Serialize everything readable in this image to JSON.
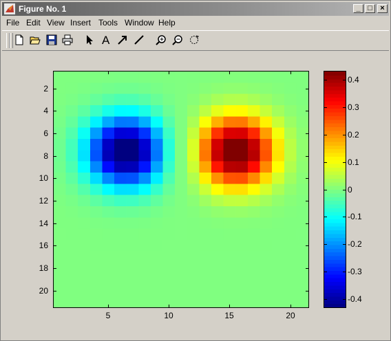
{
  "window": {
    "title": "Figure No. 1",
    "minimize_glyph": "_",
    "maximize_glyph": "□",
    "close_glyph": "×"
  },
  "menu": {
    "items": [
      {
        "label": "File"
      },
      {
        "label": "Edit"
      },
      {
        "label": "View"
      },
      {
        "label": "Insert"
      },
      {
        "label": "Tools"
      },
      {
        "label": "Window"
      },
      {
        "label": "Help"
      }
    ]
  },
  "toolbar": {
    "text_tool_label": "A",
    "tools": [
      "new-figure-icon",
      "open-file-icon",
      "save-icon",
      "print-icon",
      "select-arrow-icon",
      "text-icon",
      "arrow-icon",
      "line-icon",
      "zoom-in-icon",
      "zoom-out-icon",
      "rotate-3d-icon"
    ]
  },
  "chart_data": {
    "type": "heatmap",
    "title": "",
    "xlabel": "",
    "ylabel": "",
    "x_range": [
      0.5,
      21.5
    ],
    "y_range": [
      0.5,
      21.5
    ],
    "y_reversed": true,
    "x_ticks": [
      5,
      10,
      15,
      20
    ],
    "x_tick_labels": [
      "5",
      "10",
      "15",
      "20"
    ],
    "y_ticks": [
      2,
      4,
      6,
      8,
      10,
      12,
      14,
      16,
      18,
      20
    ],
    "y_tick_labels": [
      "2",
      "4",
      "6",
      "8",
      "10",
      "12",
      "14",
      "16",
      "18",
      "20"
    ],
    "grid_size": [
      21,
      21
    ],
    "values": [
      [
        -0.0001,
        -0.0003,
        -0.0008,
        -0.0016,
        -0.0025,
        -0.0031,
        -0.0031,
        -0.0025,
        -0.0014,
        -0.0005,
        0.0,
        0.0005,
        0.0014,
        0.0025,
        0.0031,
        0.0031,
        0.0025,
        0.0016,
        0.0008,
        0.0003,
        0.0001
      ],
      [
        -0.0004,
        -0.0014,
        -0.0036,
        -0.0069,
        -0.0105,
        -0.0129,
        -0.0128,
        -0.0102,
        -0.0061,
        -0.0021,
        0.0,
        0.0021,
        0.0061,
        0.0102,
        0.0128,
        0.0129,
        0.0105,
        0.0069,
        0.0036,
        0.0014,
        0.0004
      ],
      [
        -0.0014,
        -0.0047,
        -0.0118,
        -0.0227,
        -0.0345,
        -0.0424,
        -0.042,
        -0.0334,
        -0.0201,
        -0.007,
        0.0,
        0.007,
        0.0201,
        0.0334,
        0.042,
        0.0424,
        0.0345,
        0.0227,
        0.0118,
        0.0047,
        0.0014
      ],
      [
        -0.0035,
        -0.012,
        -0.0303,
        -0.0583,
        -0.0887,
        -0.1089,
        -0.108,
        -0.0859,
        -0.0515,
        -0.0179,
        0.0,
        0.0179,
        0.0515,
        0.0859,
        0.108,
        0.1089,
        0.0887,
        0.0583,
        0.0303,
        0.012,
        0.0035
      ],
      [
        -0.0071,
        -0.0243,
        -0.0614,
        -0.118,
        -0.1794,
        -0.2203,
        -0.2184,
        -0.1738,
        -0.1042,
        -0.0363,
        0.0,
        0.0363,
        0.1042,
        0.1738,
        0.2184,
        0.2203,
        0.1794,
        0.118,
        0.0614,
        0.0243,
        0.0071
      ],
      [
        -0.0114,
        -0.0391,
        -0.0989,
        -0.1902,
        -0.289,
        -0.3548,
        -0.3518,
        -0.2799,
        -0.1678,
        -0.0585,
        0.0,
        0.0585,
        0.1678,
        0.2799,
        0.3518,
        0.3548,
        0.289,
        0.1902,
        0.0989,
        0.0391,
        0.0114
      ],
      [
        -0.0146,
        -0.0502,
        -0.1271,
        -0.2444,
        -0.3714,
        -0.456,
        -0.452,
        -0.3597,
        -0.2157,
        -0.0751,
        0.0,
        0.0751,
        0.2157,
        0.3597,
        0.452,
        0.456,
        0.3714,
        0.2444,
        0.1271,
        0.0502,
        0.0146
      ],
      [
        -0.015,
        -0.0517,
        -0.1308,
        -0.2514,
        -0.3821,
        -0.4691,
        -0.465,
        -0.37,
        -0.2219,
        -0.0773,
        0.0,
        0.0773,
        0.2219,
        0.37,
        0.465,
        0.4691,
        0.3821,
        0.2514,
        0.1308,
        0.0517,
        0.015
      ],
      [
        -0.0123,
        -0.0425,
        -0.1076,
        -0.2068,
        -0.3143,
        -0.3859,
        -0.3825,
        -0.3044,
        -0.1825,
        -0.0636,
        0.0,
        0.0636,
        0.1825,
        0.3044,
        0.3825,
        0.3859,
        0.3143,
        0.2068,
        0.1076,
        0.0425,
        0.0123
      ],
      [
        -0.0081,
        -0.028,
        -0.0708,
        -0.136,
        -0.2067,
        -0.2538,
        -0.2516,
        -0.2002,
        -0.12,
        -0.0418,
        0.0,
        0.0418,
        0.12,
        0.2002,
        0.2516,
        0.2538,
        0.2067,
        0.136,
        0.0708,
        0.028,
        0.0081
      ],
      [
        -0.0043,
        -0.0147,
        -0.0372,
        -0.0716,
        -0.1088,
        -0.1336,
        -0.1324,
        -0.1054,
        -0.0632,
        -0.022,
        0.0,
        0.022,
        0.0632,
        0.1054,
        0.1324,
        0.1336,
        0.1088,
        0.0716,
        0.0372,
        0.0147,
        0.0043
      ],
      [
        -0.0018,
        -0.0062,
        -0.0156,
        -0.03,
        -0.0456,
        -0.056,
        -0.0555,
        -0.0442,
        -0.0265,
        -0.0092,
        0.0,
        0.0092,
        0.0265,
        0.0442,
        0.0555,
        0.056,
        0.0456,
        0.03,
        0.0156,
        0.0062,
        0.0018
      ],
      [
        -0.0006,
        -0.0021,
        -0.0052,
        -0.01,
        -0.0152,
        -0.0187,
        -0.0185,
        -0.0147,
        -0.0088,
        -0.0031,
        0.0,
        0.0031,
        0.0088,
        0.0147,
        0.0185,
        0.0187,
        0.0152,
        0.01,
        0.0052,
        0.0021,
        0.0006
      ],
      [
        -0.0002,
        -0.0006,
        -0.0014,
        -0.0027,
        -0.004,
        -0.005,
        -0.0049,
        -0.0039,
        -0.0024,
        -0.0008,
        0.0,
        0.0008,
        0.0024,
        0.0039,
        0.0049,
        0.005,
        0.004,
        0.0027,
        0.0014,
        0.0006,
        0.0002
      ],
      [
        0.0,
        -0.0001,
        -0.0003,
        -0.0006,
        -0.0009,
        -0.0011,
        -0.0011,
        -0.0008,
        -0.0005,
        -0.0002,
        0.0,
        0.0002,
        0.0005,
        0.0008,
        0.0011,
        0.0011,
        0.0009,
        0.0006,
        0.0003,
        0.0001,
        0.0
      ],
      [
        0.0,
        0.0,
        0.0,
        -0.0001,
        -0.0002,
        -0.0002,
        -0.0002,
        -0.0001,
        -0.0001,
        0.0,
        0.0,
        0.0,
        0.0001,
        0.0001,
        0.0002,
        0.0002,
        0.0002,
        0.0001,
        0.0,
        0.0,
        0.0
      ],
      [
        0.0,
        0.0,
        0.0,
        0.0,
        0.0,
        0.0,
        0.0,
        0.0,
        0.0,
        0.0,
        0.0,
        0.0,
        0.0,
        0.0,
        0.0,
        0.0,
        0.0,
        0.0,
        0.0,
        0.0,
        0.0
      ],
      [
        0.0,
        0.0,
        0.0,
        0.0,
        0.0,
        0.0,
        0.0,
        0.0,
        0.0,
        0.0,
        0.0,
        0.0,
        0.0,
        0.0,
        0.0,
        0.0,
        0.0,
        0.0,
        0.0,
        0.0,
        0.0
      ],
      [
        0.0,
        0.0,
        0.0,
        0.0,
        0.0,
        0.0,
        0.0,
        0.0,
        0.0,
        0.0,
        0.0,
        0.0,
        0.0,
        0.0,
        0.0,
        0.0,
        0.0,
        0.0,
        0.0,
        0.0,
        0.0
      ],
      [
        0.0,
        0.0,
        0.0,
        0.0,
        0.0,
        0.0,
        0.0,
        0.0,
        0.0,
        0.0,
        0.0,
        0.0,
        0.0,
        0.0,
        0.0,
        0.0,
        0.0,
        0.0,
        0.0,
        0.0,
        0.0
      ],
      [
        0.0,
        0.0,
        0.0,
        0.0,
        0.0,
        0.0,
        0.0,
        0.0,
        0.0,
        0.0,
        0.0,
        0.0,
        0.0,
        0.0,
        0.0,
        0.0,
        0.0,
        0.0,
        0.0,
        0.0,
        0.0
      ]
    ],
    "colormap": "jet",
    "clim": [
      -0.43,
      0.43
    ],
    "colorbar": {
      "placement": "right",
      "ticks": [
        0.4,
        0.3,
        0.2,
        0.1,
        0,
        -0.1,
        -0.2,
        -0.3,
        -0.4
      ],
      "tick_labels": [
        "0.4",
        "0.3",
        "0.2",
        "0.1",
        "0",
        "-0.1",
        "-0.2",
        "-0.3",
        "-0.4"
      ]
    }
  }
}
